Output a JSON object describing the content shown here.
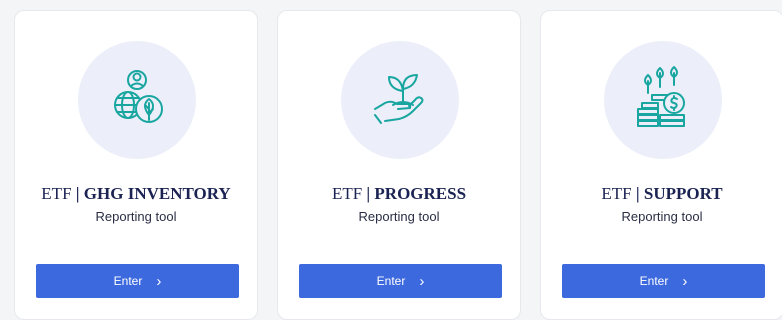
{
  "cards": [
    {
      "prefix": "ETF",
      "sep": "|",
      "name": "GHG INVENTORY",
      "subtitle": "Reporting tool",
      "button": "Enter",
      "icon": "globe-user-leaf-icon"
    },
    {
      "prefix": "ETF",
      "sep": "|",
      "name": "PROGRESS",
      "subtitle": "Reporting tool",
      "button": "Enter",
      "icon": "hand-sprout-icon"
    },
    {
      "prefix": "ETF",
      "sep": "|",
      "name": "SUPPORT",
      "subtitle": "Reporting tool",
      "button": "Enter",
      "icon": "coins-plants-icon"
    }
  ],
  "colors": {
    "accent": "#3d69df",
    "icon_stroke": "#1aa6a0",
    "icon_bg": "#eceffa",
    "title": "#1b2352"
  }
}
